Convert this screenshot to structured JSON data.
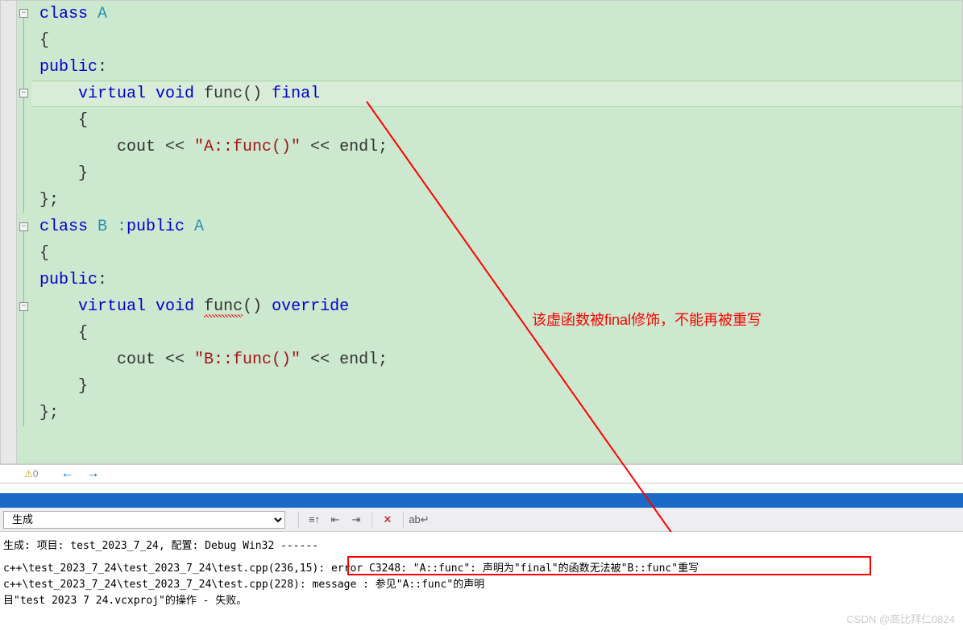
{
  "code": {
    "l1_kw_class": "class",
    "l1_A": " A",
    "l2": "{",
    "l3_kw": "public",
    "l3_colon": ":",
    "l4_indent": "    ",
    "l4_virtual": "virtual",
    "l4_void": " void",
    "l4_func": " func",
    "l4_paren": "() ",
    "l4_final": "final",
    "l5": "    {",
    "l6_indent": "        cout << ",
    "l6_str": "\"A::func()\"",
    "l6_end": " << endl;",
    "l7": "    }",
    "l8": "};",
    "l9_kw_class": "class",
    "l9_B": " B :",
    "l9_public": "public",
    "l9_A2": " A",
    "l10": "{",
    "l11_kw": "public",
    "l11_colon": ":",
    "l12_indent": "    ",
    "l12_virtual": "virtual",
    "l12_void": " void",
    "l12_func": " func",
    "l12_paren": "() ",
    "l12_override": "override",
    "l13": "    {",
    "l14_indent": "        cout << ",
    "l14_str": "\"B::func()\"",
    "l14_end": " << endl;",
    "l15": "    }",
    "l16": "};"
  },
  "annotation": "该虚函数被final修饰，不能再被重写",
  "status": {
    "warnings": "0"
  },
  "toolbar": {
    "dropdown": "生成"
  },
  "output": {
    "line1": "生成: 项目: test_2023_7_24, 配置: Debug Win32 ------",
    "line2_pre": "c++\\test_2023_7_24\\test_2023_7_24\\test.cpp(236,15): ",
    "line2_err": "error C3248: \"A::func\": 声明为\"final\"的函数无法被\"B::func\"重写",
    "line3": "c++\\test_2023_7_24\\test_2023_7_24\\test.cpp(228): message : 参见\"A::func\"的声明",
    "line4": "目\"test 2023 7 24.vcxproj\"的操作 - 失败。"
  },
  "watermark": "CSDN @高比拜仁0824"
}
